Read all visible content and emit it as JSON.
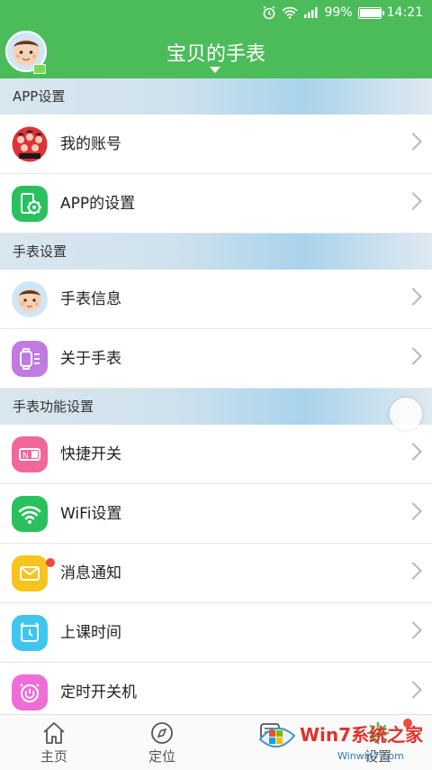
{
  "status_bar": {
    "battery": "99%",
    "time": "14:21"
  },
  "header": {
    "title": "宝贝的手表"
  },
  "sections": [
    {
      "title": "APP设置",
      "items": [
        {
          "label": "我的账号",
          "icon": "account-avatar-icon"
        },
        {
          "label": "APP的设置",
          "icon": "app-settings-icon",
          "color": "#2bc05e"
        }
      ]
    },
    {
      "title": "手表设置",
      "items": [
        {
          "label": "手表信息",
          "icon": "baby-face-icon"
        },
        {
          "label": "关于手表",
          "icon": "watch-icon",
          "color": "#c07be0"
        }
      ]
    },
    {
      "title": "手表功能设置",
      "items": [
        {
          "label": "快捷开关",
          "icon": "switch-icon",
          "color": "#f0689b"
        },
        {
          "label": "WiFi设置",
          "icon": "wifi-icon",
          "color": "#2bc05e"
        },
        {
          "label": "消息通知",
          "icon": "envelope-icon",
          "color": "#f7c31d"
        },
        {
          "label": "上课时间",
          "icon": "clock-icon",
          "color": "#3fc6ee"
        },
        {
          "label": "定时开关机",
          "icon": "power-timer-icon",
          "color": "#ee6ed6"
        }
      ]
    }
  ],
  "tabs": [
    {
      "label": "主页",
      "icon": "home-icon"
    },
    {
      "label": "定位",
      "icon": "compass-icon"
    },
    {
      "label": "",
      "icon": "chat-icon"
    },
    {
      "label": "设置",
      "icon": "gear-icon"
    }
  ],
  "watermark": {
    "brand": "Win7系统之家",
    "site": "Winwin7.com"
  },
  "colors": {
    "header": "#4cbc5a",
    "badge": "#f04a3d"
  }
}
